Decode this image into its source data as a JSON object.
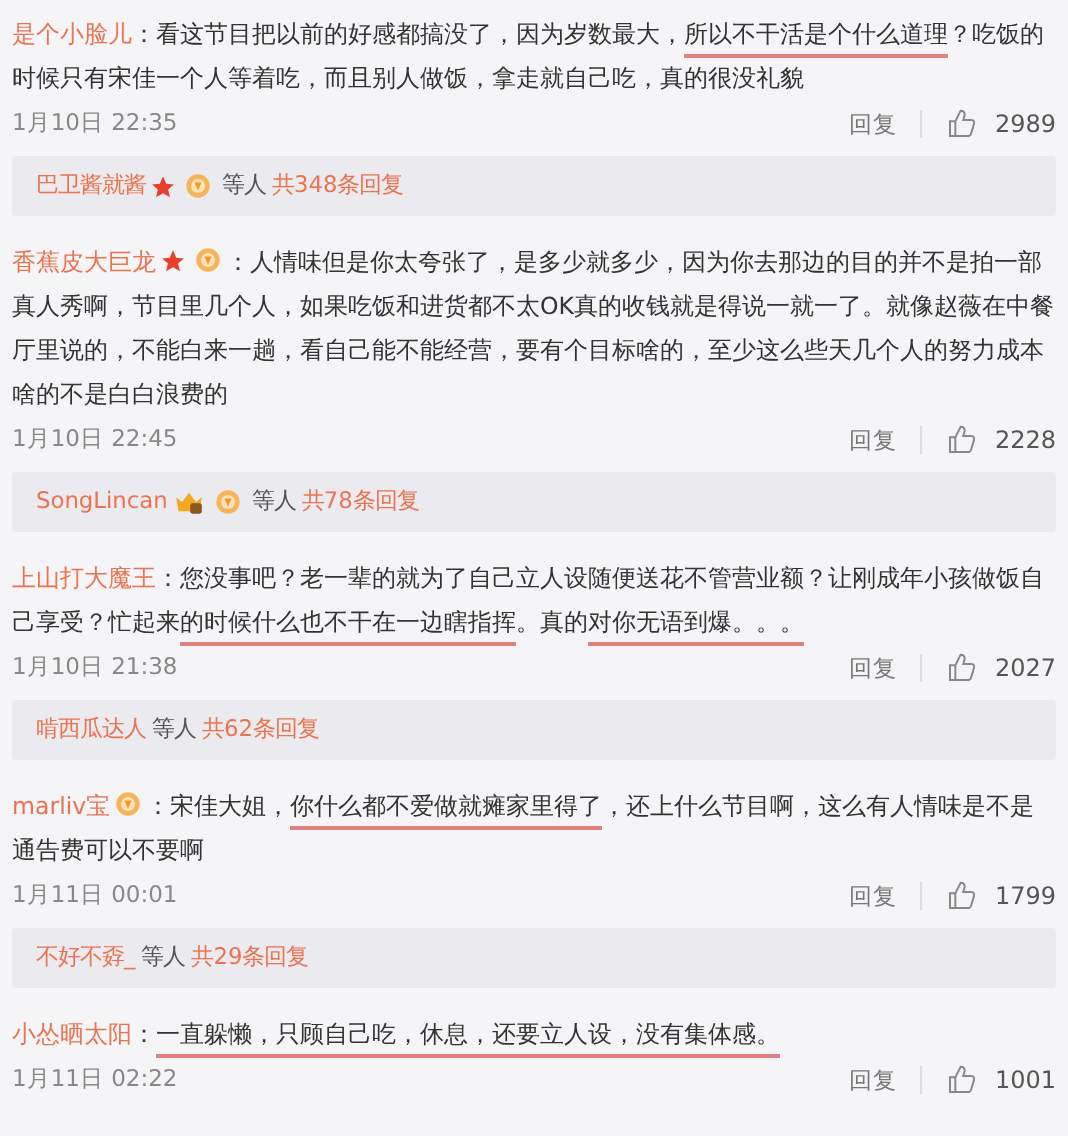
{
  "comments": [
    {
      "user": "是个小脸儿",
      "colon": "：",
      "segments": [
        {
          "text": "看这节目把以前的好感都搞没了，因为岁数最大，",
          "underlined": false
        },
        {
          "text": "所以不干活是个什么道理",
          "underlined": true
        },
        {
          "text": "？吃饭的时候只有宋佳一个人等着吃，而且别人做饭，拿走就自己吃，真的很没礼貌",
          "underlined": false
        }
      ],
      "time": "1月10日 22:35",
      "reply": "回复",
      "likes": "2989",
      "summary": {
        "user": "巴卫酱就酱",
        "badges": [
          {
            "kind": "star"
          },
          {
            "kind": "medal"
          }
        ],
        "others": "等人",
        "count": "共348条回复"
      }
    },
    {
      "user": "香蕉皮大巨龙",
      "badges": [
        {
          "kind": "star"
        },
        {
          "kind": "medal"
        }
      ],
      "colon": "：",
      "segments": [
        {
          "text": "人情味但是你太夸张了，是多少就多少，因为你去那边的目的并不是拍一部真人秀啊，节目里几个人，如果吃饭和进货都不太OK真的收钱就是得说一就一了。就像赵薇在中餐厅里说的，不能白来一趟，看自己能不能经营，要有个目标啥的，至少这么些天几个人的努力成本啥的不是白白浪费的",
          "underlined": false
        }
      ],
      "time": "1月10日 22:45",
      "reply": "回复",
      "likes": "2228",
      "summary": {
        "user": "SongLincan",
        "badges": [
          {
            "kind": "vip"
          },
          {
            "kind": "medal"
          }
        ],
        "others": "等人",
        "count": "共78条回复"
      }
    },
    {
      "user": "上山打大魔王",
      "colon": "：",
      "segments": [
        {
          "text": "您没事吧？老一辈的就为了自己立人设随便送花不管营业额？让刚成年小孩做饭自己享受？忙起来",
          "underlined": false
        },
        {
          "text": "的时候什么也不干在一边瞎指挥",
          "underlined": true
        },
        {
          "text": "。真的",
          "underlined": false
        },
        {
          "text": "对你无语到爆。。。",
          "underlined": true
        }
      ],
      "time": "1月10日 21:38",
      "reply": "回复",
      "likes": "2027",
      "summary": {
        "user": "啃西瓜达人",
        "others": "等人",
        "count": "共62条回复"
      }
    },
    {
      "user": "marliv宝",
      "badges": [
        {
          "kind": "medal"
        }
      ],
      "colon": "：",
      "segments": [
        {
          "text": "宋佳大姐，",
          "underlined": false
        },
        {
          "text": "你什么都不爱做就瘫家里得了",
          "underlined": true
        },
        {
          "text": "，还上什么节目啊，这么有人情味是不是通告费可以不要啊",
          "underlined": false
        }
      ],
      "time": "1月11日 00:01",
      "reply": "回复",
      "likes": "1799",
      "summary": {
        "user": "不好不孬_",
        "others": "等人",
        "count": "共29条回复"
      }
    },
    {
      "user": "小怂晒太阳",
      "colon": "：",
      "segments": [
        {
          "text": "一直躲懒，只顾自己吃，休息，还要立人设，没有集体感。",
          "underlined": true
        }
      ],
      "time": "1月11日 02:22",
      "reply": "回复",
      "likes": "1001"
    }
  ]
}
